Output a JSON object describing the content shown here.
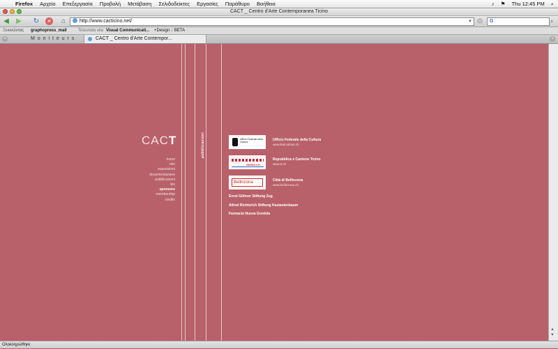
{
  "menubar": {
    "app": "Firefox",
    "items": [
      "Αρχείο",
      "Επεξεργασία",
      "Προβολή",
      "Μετάβαση",
      "Σελιδοδείκτες",
      "Εργασίες",
      "Παράθυρο",
      "Βοήθεια"
    ],
    "clock": "Thu 12:45 PM"
  },
  "window": {
    "title": "CACT _ Centro d'Arte Contemporanea Ticino"
  },
  "toolbar": {
    "url": "http://www.cacticino.net/",
    "search_text": "G"
  },
  "bookmarks": [
    "Ξεκινώντας",
    "graphopress_mail",
    "Τελευταία νέα",
    "Visual Communicati...",
    "+Design :: BETA"
  ],
  "tabs": [
    {
      "label": "M o n i t e u r s"
    },
    {
      "label": "CACT _ Centro d'Arte Contempor..."
    }
  ],
  "site": {
    "logo_light": "CAC",
    "logo_bold": "T",
    "nav": [
      "home",
      "mio",
      "esposizioni",
      "documentazione",
      "pubblicazioni",
      "bio",
      "sponsors",
      "membership",
      "credits"
    ],
    "current_nav": "sponsors",
    "vertical_label": "pubblicazioni",
    "sponsors": [
      {
        "title": "Ufficio Federale della Cultura",
        "url": "www.bak.admin.ch",
        "logo_text": "Ufficio Federale della Cultura"
      },
      {
        "title": "Repubblica e Cantone Ticino",
        "url": "www.ti.ch",
        "logo_text": "SWISS.CH"
      },
      {
        "title": "Città di Bellinzona",
        "url": "www.bellinzona.ch",
        "logo_text": "Bellinzona"
      }
    ],
    "foundations": [
      "Ernst Göhner Stiftung Zug",
      "Alfred Richterich Stiftung Kastanienbaum",
      "Farmacia Nuova Gordola"
    ]
  },
  "statusbar": {
    "text": "Ολοκληρώθηκε"
  }
}
